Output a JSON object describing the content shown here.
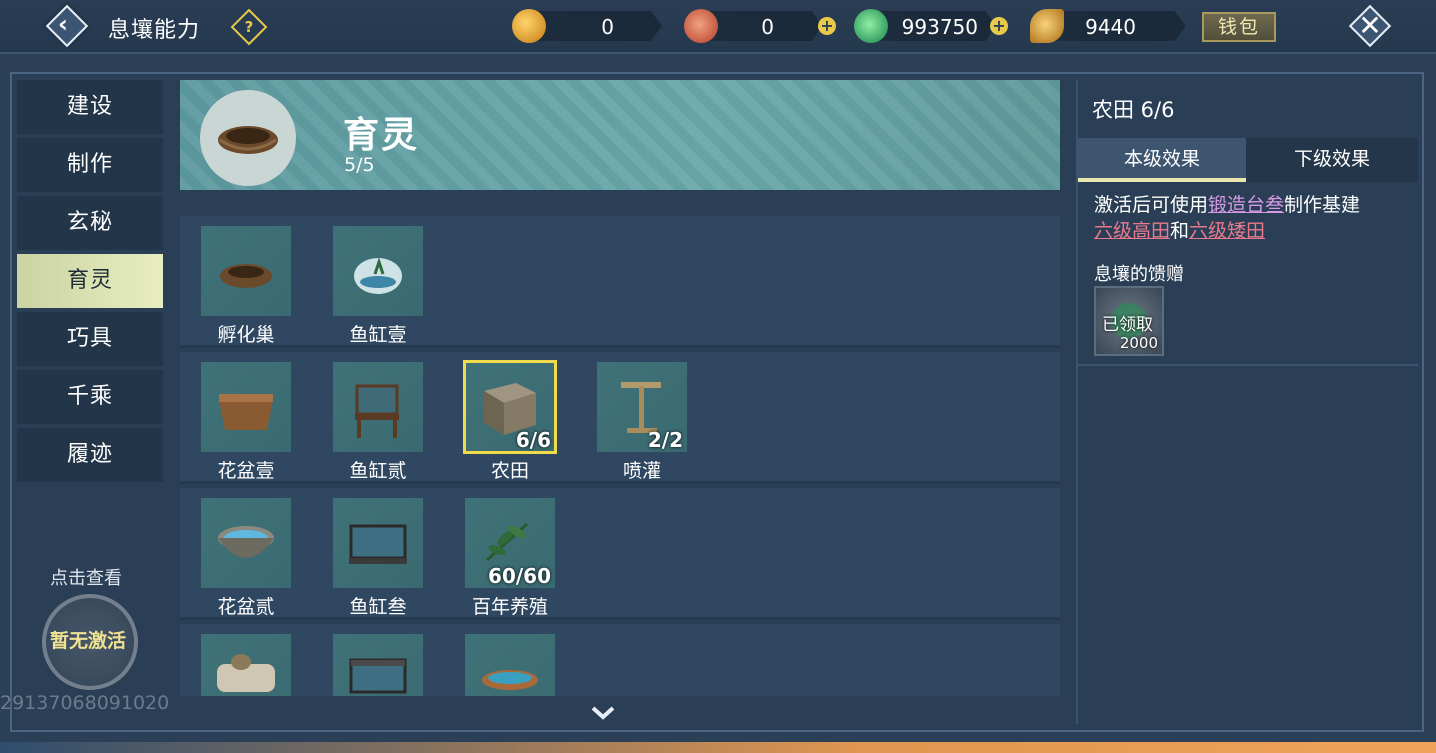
{
  "header": {
    "title": "息壤能力",
    "help_symbol": "?",
    "currencies": [
      {
        "icon": "gold-gourd-icon",
        "value": "0",
        "has_plus": false
      },
      {
        "icon": "red-swirl-icon",
        "value": "0",
        "has_plus": true
      },
      {
        "icon": "jade-coin-icon",
        "value": "993750",
        "has_plus": true
      },
      {
        "icon": "gold-leaf-icon",
        "value": "9440",
        "has_plus": false
      }
    ],
    "wallet_label": "钱包",
    "plus_symbol": "+"
  },
  "sidebar": {
    "items": [
      {
        "label": "建设",
        "active": false
      },
      {
        "label": "制作",
        "active": false
      },
      {
        "label": "玄秘",
        "active": false
      },
      {
        "label": "育灵",
        "active": true
      },
      {
        "label": "巧具",
        "active": false
      },
      {
        "label": "千乘",
        "active": false
      },
      {
        "label": "履迹",
        "active": false
      }
    ],
    "tap_to_view": "点击查看",
    "seal_status": "暂无激活",
    "player_id": "29137068091020"
  },
  "banner": {
    "title": "育灵",
    "count": "5/5",
    "icon": "nest-icon"
  },
  "grid": {
    "rows": [
      [
        {
          "name": "孵化巢",
          "count": "",
          "icon": "nest-icon"
        },
        {
          "name": "鱼缸壹",
          "count": "",
          "icon": "fishbowl-icon"
        }
      ],
      [
        {
          "name": "花盆壹",
          "count": "",
          "icon": "planter-box-icon"
        },
        {
          "name": "鱼缸贰",
          "count": "",
          "icon": "fish-tank-stand-icon"
        },
        {
          "name": "农田",
          "count": "6/6",
          "icon": "farmland-block-icon",
          "selected": true
        },
        {
          "name": "喷灌",
          "count": "2/2",
          "icon": "sprinkler-icon"
        }
      ],
      [
        {
          "name": "花盆贰",
          "count": "",
          "icon": "water-basin-icon"
        },
        {
          "name": "鱼缸叁",
          "count": "",
          "icon": "aquarium-icon"
        },
        {
          "name": "百年养殖",
          "count": "60/60",
          "icon": "herb-sprig-icon"
        }
      ],
      [
        {
          "name": "",
          "count": "",
          "icon": "stone-trough-icon"
        },
        {
          "name": "",
          "count": "",
          "icon": "aquarium-large-icon"
        },
        {
          "name": "",
          "count": "",
          "icon": "blue-bowl-icon"
        }
      ]
    ]
  },
  "detail": {
    "title": "农田 6/6",
    "tabs": [
      {
        "label": "本级效果",
        "active": true
      },
      {
        "label": "下级效果",
        "active": false
      }
    ],
    "effect": {
      "prefix": "激活后可使用",
      "link1": "锻造台叁",
      "mid": "制作基建",
      "link2": "六级高田",
      "and": "和",
      "link3": "六级矮田"
    },
    "gift_label": "息壤的馈赠",
    "gift_status": "已领取",
    "gift_amount": "2000"
  },
  "colors": {
    "accent_yellow": "#f0dc4b",
    "link_violet": "#d79ae6",
    "link_pink": "#e87a8c",
    "active_tab_bg": "#cbd3a2"
  }
}
